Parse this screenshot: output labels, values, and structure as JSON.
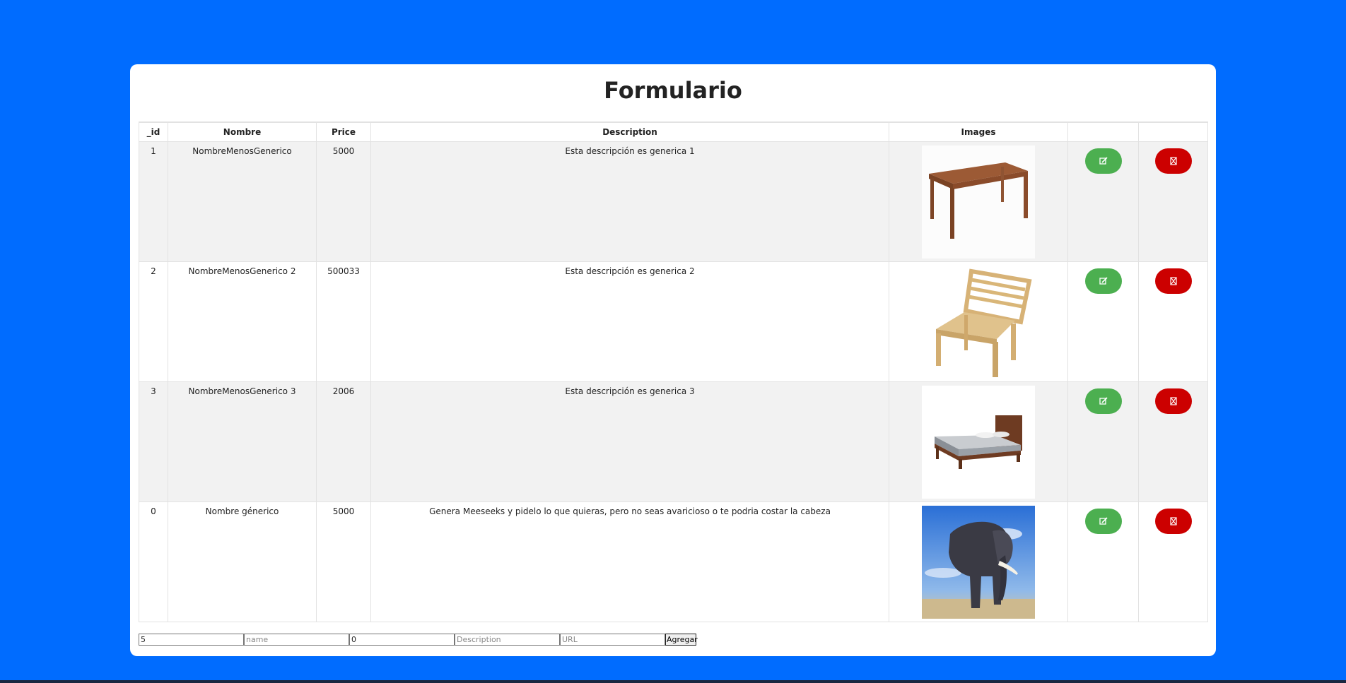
{
  "page": {
    "title": "Formulario",
    "background_color": "#006cff"
  },
  "table": {
    "headers": [
      "_id",
      "Nombre",
      "Price",
      "Description",
      "Images",
      "",
      ""
    ],
    "rows": [
      {
        "id": "1",
        "name": "NombreMenosGenerico",
        "price": "5000",
        "description": "Esta descripción es generica 1",
        "image": "wooden-table"
      },
      {
        "id": "2",
        "name": "NombreMenosGenerico 2",
        "price": "500033",
        "description": "Esta descripción es generica 2",
        "image": "wooden-chair"
      },
      {
        "id": "3",
        "name": "NombreMenosGenerico 3",
        "price": "2006",
        "description": "Esta descripción es generica 3",
        "image": "wooden-bed"
      },
      {
        "id": "0",
        "name": "Nombre génerico",
        "price": "5000",
        "description": "Genera Meeseeks y pidelo lo que quieras, pero no seas avaricioso o te podria costar la cabeza",
        "image": "elephant"
      }
    ],
    "edit_icon": "edit-icon",
    "delete_icon": "delete-icon",
    "edit_color": "#4caf50",
    "delete_color": "#cc0000"
  },
  "form": {
    "id_value": "5",
    "name_placeholder": "name",
    "price_value": "0",
    "description_placeholder": "Description",
    "url_placeholder": "URL",
    "submit_label": "Agregar"
  }
}
